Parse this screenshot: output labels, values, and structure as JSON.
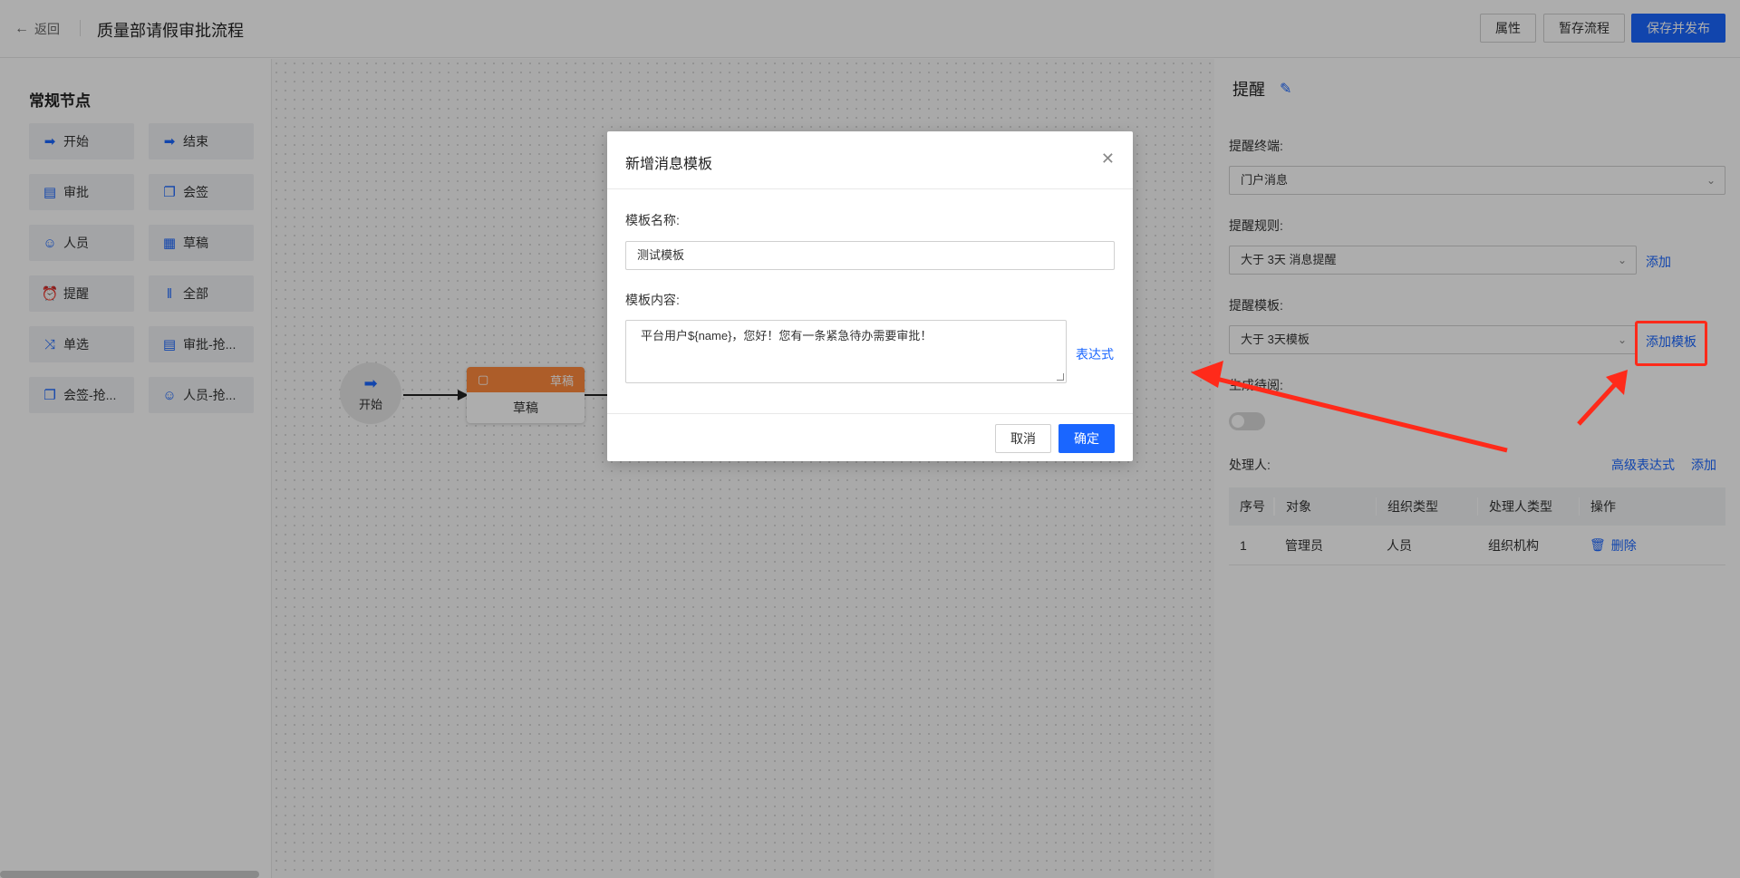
{
  "header": {
    "back_label": "返回",
    "title": "质量部请假审批流程",
    "buttons": {
      "attr": "属性",
      "draft": "暂存流程",
      "publish": "保存并发布"
    }
  },
  "left_panel": {
    "section_title": "常规节点",
    "nodes": [
      {
        "label": "开始",
        "icon": "arrow-right-icon"
      },
      {
        "label": "结束",
        "icon": "arrow-end-icon"
      },
      {
        "label": "审批",
        "icon": "document-person-icon"
      },
      {
        "label": "会签",
        "icon": "stacked-docs-icon"
      },
      {
        "label": "人员",
        "icon": "user-icon"
      },
      {
        "label": "草稿",
        "icon": "calendar-icon"
      },
      {
        "label": "提醒",
        "icon": "alarm-clock-icon"
      },
      {
        "label": "全部",
        "icon": "parallel-bars-icon"
      },
      {
        "label": "单选",
        "icon": "shuffle-icon"
      },
      {
        "label": "审批-抢...",
        "icon": "document-person-icon"
      },
      {
        "label": "会签-抢...",
        "icon": "stacked-docs-icon"
      },
      {
        "label": "人员-抢...",
        "icon": "user-icon"
      }
    ]
  },
  "canvas": {
    "start_node": "开始",
    "draft_node": {
      "header": "草稿",
      "label": "草稿"
    }
  },
  "right_panel": {
    "title": "提醒",
    "terminal_label": "提醒终端:",
    "terminal_value": "门户消息",
    "rule_label": "提醒规则:",
    "rule_value": "大于 3天 消息提醒",
    "rule_add": "添加",
    "template_label": "提醒模板:",
    "template_value": "大于 3天模板",
    "template_add": "添加模板",
    "wait_label": "生成待阅:",
    "handler_label": "处理人:",
    "advanced_expr": "高级表达式",
    "handler_add": "添加",
    "table": {
      "headers": [
        "序号",
        "对象",
        "组织类型",
        "处理人类型",
        "操作"
      ],
      "rows": [
        {
          "index": "1",
          "object": "管理员",
          "org_type": "人员",
          "handler_type": "组织机构",
          "action": "删除"
        }
      ]
    }
  },
  "modal": {
    "title": "新增消息模板",
    "name_label": "模板名称:",
    "name_value": "测试模板",
    "content_label": "模板内容:",
    "content_value": "平台用户${name}，您好！您有一条紧急待办需要审批！",
    "expr_link": "表达式",
    "cancel": "取消",
    "ok": "确定"
  },
  "colors": {
    "primary": "#1a66ff",
    "annotation_red": "#ff2a1a",
    "draft_orange": "#ff8a3d"
  }
}
